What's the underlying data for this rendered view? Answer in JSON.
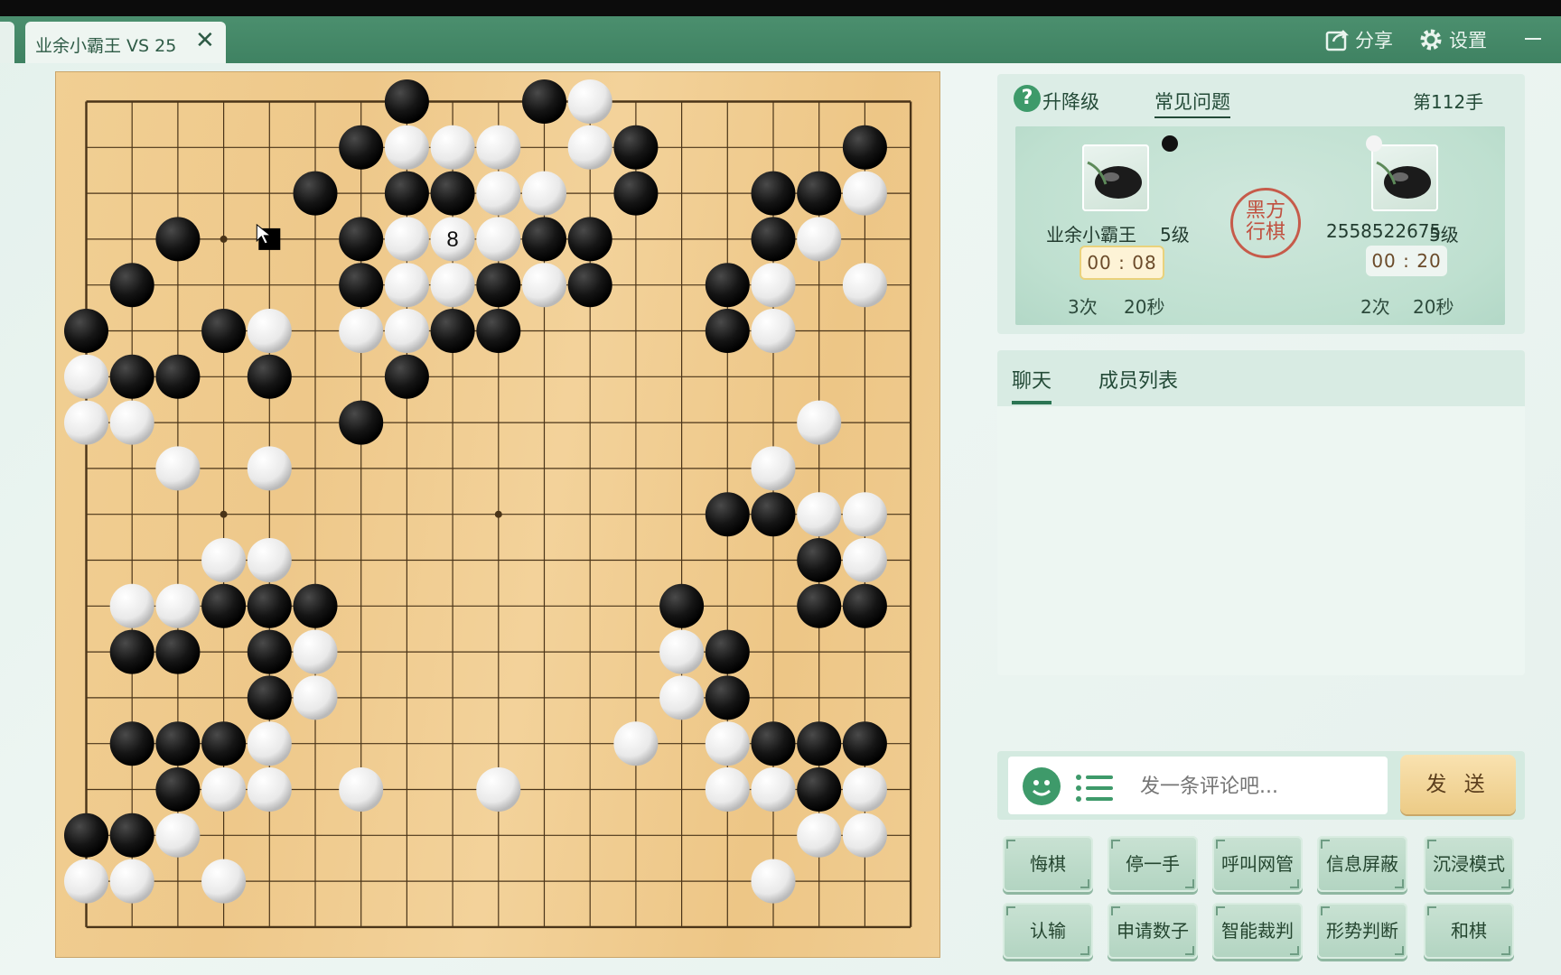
{
  "window": {
    "tab_title": "业余小霸王 VS 25",
    "share_label": "分享",
    "settings_label": "设置",
    "icons": [
      "close-icon",
      "share-icon",
      "gear-icon",
      "minimize-icon"
    ]
  },
  "board": {
    "size": 19,
    "last_move_marker": "8",
    "coordinates_note": "stones listed as [column, row] with 0-based indices from top-left intersection",
    "black": [
      [
        7,
        0
      ],
      [
        10,
        0
      ],
      [
        6,
        1
      ],
      [
        12,
        1
      ],
      [
        17,
        1
      ],
      [
        5,
        2
      ],
      [
        7,
        2
      ],
      [
        8,
        2
      ],
      [
        12,
        2
      ],
      [
        15,
        2
      ],
      [
        16,
        2
      ],
      [
        2,
        3
      ],
      [
        6,
        3
      ],
      [
        10,
        3
      ],
      [
        11,
        3
      ],
      [
        15,
        3
      ],
      [
        1,
        4
      ],
      [
        6,
        4
      ],
      [
        9,
        4
      ],
      [
        11,
        4
      ],
      [
        14,
        4
      ],
      [
        0,
        5
      ],
      [
        3,
        5
      ],
      [
        8,
        5
      ],
      [
        9,
        5
      ],
      [
        14,
        5
      ],
      [
        1,
        6
      ],
      [
        2,
        6
      ],
      [
        4,
        6
      ],
      [
        7,
        6
      ],
      [
        6,
        7
      ],
      [
        14,
        9
      ],
      [
        15,
        9
      ],
      [
        16,
        10
      ],
      [
        3,
        11
      ],
      [
        4,
        11
      ],
      [
        5,
        11
      ],
      [
        13,
        11
      ],
      [
        16,
        11
      ],
      [
        17,
        11
      ],
      [
        1,
        12
      ],
      [
        2,
        12
      ],
      [
        4,
        12
      ],
      [
        14,
        12
      ],
      [
        4,
        13
      ],
      [
        14,
        13
      ],
      [
        1,
        14
      ],
      [
        2,
        14
      ],
      [
        3,
        14
      ],
      [
        15,
        14
      ],
      [
        16,
        14
      ],
      [
        17,
        14
      ],
      [
        2,
        15
      ],
      [
        16,
        15
      ],
      [
        0,
        16
      ],
      [
        1,
        16
      ]
    ],
    "white": [
      [
        11,
        0
      ],
      [
        7,
        1
      ],
      [
        8,
        1
      ],
      [
        9,
        1
      ],
      [
        11,
        1
      ],
      [
        9,
        2
      ],
      [
        10,
        2
      ],
      [
        17,
        2
      ],
      [
        7,
        3
      ],
      [
        8,
        3
      ],
      [
        9,
        3
      ],
      [
        16,
        3
      ],
      [
        7,
        4
      ],
      [
        8,
        4
      ],
      [
        10,
        4
      ],
      [
        15,
        4
      ],
      [
        17,
        4
      ],
      [
        4,
        5
      ],
      [
        6,
        5
      ],
      [
        7,
        5
      ],
      [
        15,
        5
      ],
      [
        0,
        6
      ],
      [
        0,
        7
      ],
      [
        1,
        7
      ],
      [
        16,
        7
      ],
      [
        2,
        8
      ],
      [
        4,
        8
      ],
      [
        15,
        8
      ],
      [
        16,
        9
      ],
      [
        17,
        9
      ],
      [
        3,
        10
      ],
      [
        4,
        10
      ],
      [
        17,
        10
      ],
      [
        1,
        11
      ],
      [
        2,
        11
      ],
      [
        5,
        12
      ],
      [
        13,
        12
      ],
      [
        5,
        13
      ],
      [
        13,
        13
      ],
      [
        4,
        14
      ],
      [
        12,
        14
      ],
      [
        14,
        14
      ],
      [
        3,
        15
      ],
      [
        4,
        15
      ],
      [
        6,
        15
      ],
      [
        9,
        15
      ],
      [
        14,
        15
      ],
      [
        15,
        15
      ],
      [
        17,
        15
      ],
      [
        2,
        16
      ],
      [
        16,
        16
      ],
      [
        17,
        16
      ],
      [
        0,
        17
      ],
      [
        1,
        17
      ],
      [
        3,
        17
      ],
      [
        15,
        17
      ]
    ],
    "marked_stone": [
      8,
      3
    ],
    "marker_square": [
      4,
      3
    ]
  },
  "info": {
    "rank_label": "升降级",
    "faq_label": "常见问题",
    "move_count": "第112手",
    "player_black": {
      "name": "业余小霸王",
      "rank": "5级",
      "time": "00 : 08",
      "byoyomi_count": "3次",
      "byoyomi_time": "20秒"
    },
    "player_white": {
      "name": "2558522675",
      "rank": "5级",
      "time": "00 : 20",
      "byoyomi_count": "2次",
      "byoyomi_time": "20秒"
    },
    "turn_seal": "黑方行棋"
  },
  "chat": {
    "tab_chat": "聊天",
    "tab_members": "成员列表",
    "placeholder": "发一条评论吧...",
    "send_label": "发 送"
  },
  "actions": {
    "row1": [
      "悔棋",
      "停一手",
      "呼叫网管",
      "信息屏蔽",
      "沉浸模式"
    ],
    "row2": [
      "认输",
      "申请数子",
      "智能裁判",
      "形势判断",
      "和棋"
    ]
  },
  "colors": {
    "titlebar": "#3f8262",
    "accent": "#2b7553",
    "board": "#efcb8e"
  }
}
